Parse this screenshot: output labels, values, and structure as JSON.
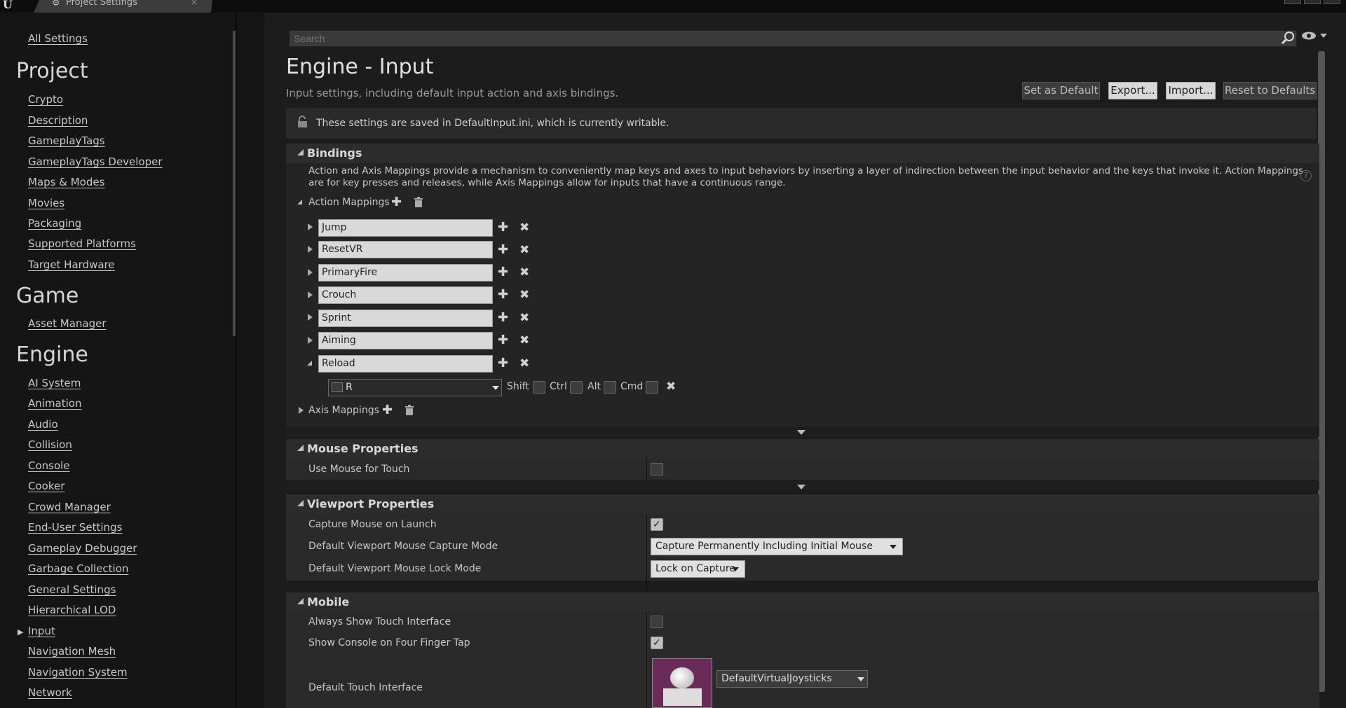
{
  "window": {
    "tab_title": "Project Settings",
    "tab_close": "×",
    "logo": "U"
  },
  "sidebar": {
    "all_settings": "All Settings",
    "project_heading": "Project",
    "project_items": [
      "Crypto",
      "Description",
      "GameplayTags",
      "GameplayTags Developer",
      "Maps & Modes",
      "Movies",
      "Packaging",
      "Supported Platforms",
      "Target Hardware"
    ],
    "game_heading": "Game",
    "game_items": [
      "Asset Manager"
    ],
    "engine_heading": "Engine",
    "engine_items": [
      "AI System",
      "Animation",
      "Audio",
      "Collision",
      "Console",
      "Cooker",
      "Crowd Manager",
      "End-User Settings",
      "Gameplay Debugger",
      "Garbage Collection",
      "General Settings",
      "Hierarchical LOD",
      "Input",
      "Navigation Mesh",
      "Navigation System",
      "Network"
    ],
    "selected": "Input"
  },
  "search": {
    "placeholder": "Search"
  },
  "header": {
    "title": "Engine - Input",
    "subtitle": "Input settings, including default input action and axis bindings.",
    "set_default": "Set as Default",
    "export": "Export...",
    "import": "Import...",
    "reset": "Reset to Defaults"
  },
  "notice": "These settings are saved in DefaultInput.ini, which is currently writable.",
  "bindings": {
    "heading": "Bindings",
    "description": "Action and Axis Mappings provide a mechanism to conveniently map keys and axes to input behaviors by inserting a layer of indirection between the input behavior and the keys that invoke it. Action Mappings are for key presses and releases, while Axis Mappings allow for inputs that have a continuous range.",
    "action_mappings_label": "Action Mappings",
    "action_mappings": [
      "Jump",
      "ResetVR",
      "PrimaryFire",
      "Crouch",
      "Sprint",
      "Aiming",
      "Reload"
    ],
    "reload_key": "R",
    "modifiers": {
      "shift": "Shift",
      "ctrl": "Ctrl",
      "alt": "Alt",
      "cmd": "Cmd"
    },
    "axis_mappings_label": "Axis Mappings"
  },
  "mouse": {
    "heading": "Mouse Properties",
    "use_mouse_for_touch": "Use Mouse for Touch"
  },
  "viewport": {
    "heading": "Viewport Properties",
    "capture_on_launch": "Capture Mouse on Launch",
    "capture_mode_label": "Default Viewport Mouse Capture Mode",
    "capture_mode_value": "Capture Permanently Including Initial Mouse Down",
    "lock_mode_label": "Default Viewport Mouse Lock Mode",
    "lock_mode_value": "Lock on Capture"
  },
  "mobile": {
    "heading": "Mobile",
    "always_show_touch": "Always Show Touch Interface",
    "console_four_finger": "Show Console on Four Finger Tap",
    "default_touch_label": "Default Touch Interface",
    "default_touch_value": "DefaultVirtualJoysticks"
  },
  "icons": {
    "search": "search-icon",
    "eye": "eye-icon",
    "lock": "lock-icon",
    "help": "help-icon",
    "plus": "+",
    "close": "✖",
    "trash": "🗑",
    "check": "✓"
  }
}
